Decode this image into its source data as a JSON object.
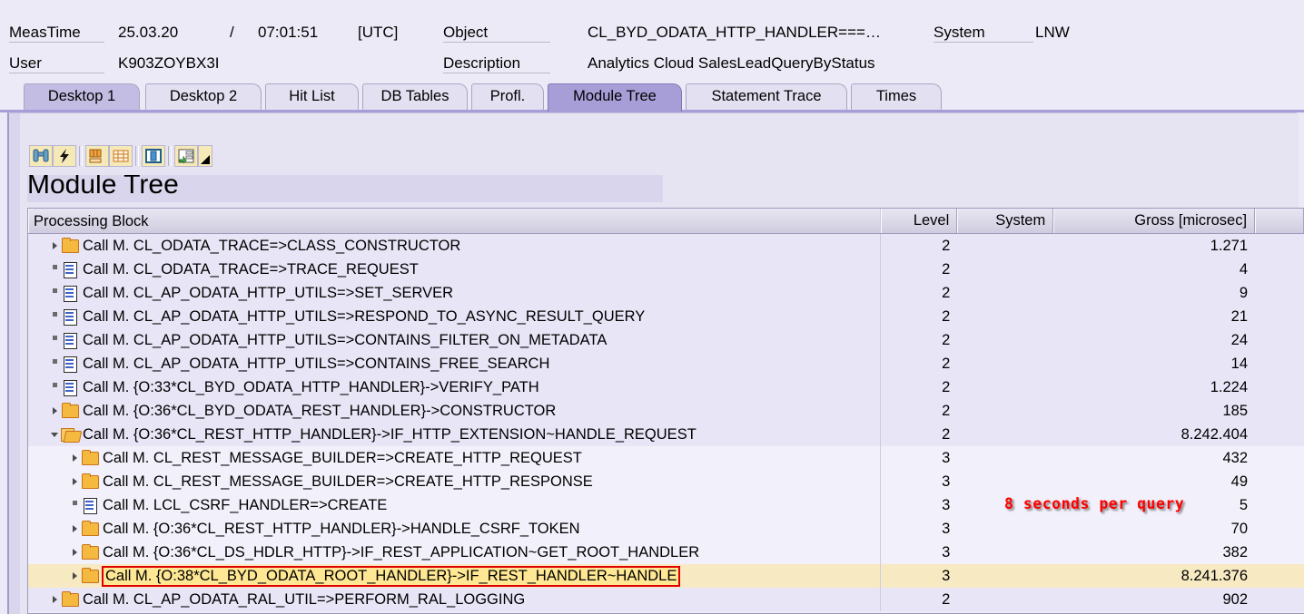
{
  "header": {
    "meastime_label": "MeasTime",
    "meastime_date": "25.03.20",
    "separator": "/",
    "meastime_time": "07:01:51",
    "timezone": "[UTC]",
    "user_label": "User",
    "user_value": "K903ZOYBX3I",
    "object_label": "Object",
    "object_value": "CL_BYD_ODATA_HTTP_HANDLER===…",
    "system_label": "System",
    "system_value": "LNW",
    "description_label": "Description",
    "description_value": "Analytics Cloud SalesLeadQueryByStatus"
  },
  "tabs": [
    {
      "label": "Desktop 1",
      "state": "first"
    },
    {
      "label": "Desktop 2",
      "state": "normal"
    },
    {
      "label": "Hit List",
      "state": "normal"
    },
    {
      "label": "DB Tables",
      "state": "normal"
    },
    {
      "label": "Profl.",
      "state": "normal"
    },
    {
      "label": "Module Tree",
      "state": "active"
    },
    {
      "label": "Statement Trace",
      "state": "normal"
    },
    {
      "label": "Times",
      "state": "normal"
    }
  ],
  "toolbar": {
    "buttons": [
      {
        "icon": "binoculars-icon"
      },
      {
        "icon": "lightning-bolt-icon"
      },
      {
        "icon": "table-layout-icon"
      },
      {
        "icon": "grid-layout-icon"
      },
      {
        "icon": "column-select-icon"
      },
      {
        "icon": "tree-export-icon"
      }
    ]
  },
  "title": "Module Tree",
  "grid": {
    "columns": [
      {
        "key": "block",
        "label": "Processing Block"
      },
      {
        "key": "level",
        "label": "Level"
      },
      {
        "key": "system",
        "label": "System"
      },
      {
        "key": "gross",
        "label": "Gross [microsec]"
      }
    ],
    "rows": [
      {
        "indent": 1,
        "node": "collapsed",
        "icon": "folder-icon",
        "block": "Call M. CL_ODATA_TRACE=>CLASS_CONSTRUCTOR",
        "level": "2",
        "system": "",
        "gross": "1.271",
        "shade": true,
        "selected": false
      },
      {
        "indent": 1,
        "node": "leaf",
        "icon": "document-icon",
        "block": "Call M. CL_ODATA_TRACE=>TRACE_REQUEST",
        "level": "2",
        "system": "",
        "gross": "4",
        "shade": true,
        "selected": false
      },
      {
        "indent": 1,
        "node": "leaf",
        "icon": "document-icon",
        "block": "Call M. CL_AP_ODATA_HTTP_UTILS=>SET_SERVER",
        "level": "2",
        "system": "",
        "gross": "9",
        "shade": true,
        "selected": false
      },
      {
        "indent": 1,
        "node": "leaf",
        "icon": "document-icon",
        "block": "Call M. CL_AP_ODATA_HTTP_UTILS=>RESPOND_TO_ASYNC_RESULT_QUERY",
        "level": "2",
        "system": "",
        "gross": "21",
        "shade": true,
        "selected": false
      },
      {
        "indent": 1,
        "node": "leaf",
        "icon": "document-icon",
        "block": "Call M. CL_AP_ODATA_HTTP_UTILS=>CONTAINS_FILTER_ON_METADATA",
        "level": "2",
        "system": "",
        "gross": "24",
        "shade": true,
        "selected": false
      },
      {
        "indent": 1,
        "node": "leaf",
        "icon": "document-icon",
        "block": "Call M. CL_AP_ODATA_HTTP_UTILS=>CONTAINS_FREE_SEARCH",
        "level": "2",
        "system": "",
        "gross": "14",
        "shade": true,
        "selected": false
      },
      {
        "indent": 1,
        "node": "leaf",
        "icon": "document-icon",
        "block": "Call M. {O:33*CL_BYD_ODATA_HTTP_HANDLER}->VERIFY_PATH",
        "level": "2",
        "system": "",
        "gross": "1.224",
        "shade": true,
        "selected": false
      },
      {
        "indent": 1,
        "node": "collapsed",
        "icon": "folder-icon",
        "block": "Call M. {O:36*CL_BYD_ODATA_REST_HANDLER}->CONSTRUCTOR",
        "level": "2",
        "system": "",
        "gross": "185",
        "shade": true,
        "selected": false
      },
      {
        "indent": 1,
        "node": "expanded",
        "icon": "folder-open-icon",
        "block": "Call M. {O:36*CL_REST_HTTP_HANDLER}->IF_HTTP_EXTENSION~HANDLE_REQUEST",
        "level": "2",
        "system": "",
        "gross": "8.242.404",
        "shade": true,
        "selected": false
      },
      {
        "indent": 2,
        "node": "collapsed",
        "icon": "folder-icon",
        "block": "Call M. CL_REST_MESSAGE_BUILDER=>CREATE_HTTP_REQUEST",
        "level": "3",
        "system": "",
        "gross": "432",
        "shade": false,
        "selected": false
      },
      {
        "indent": 2,
        "node": "collapsed",
        "icon": "folder-icon",
        "block": "Call M. CL_REST_MESSAGE_BUILDER=>CREATE_HTTP_RESPONSE",
        "level": "3",
        "system": "",
        "gross": "49",
        "shade": false,
        "selected": false
      },
      {
        "indent": 2,
        "node": "leaf",
        "icon": "document-icon",
        "block": "Call M. LCL_CSRF_HANDLER=>CREATE",
        "level": "3",
        "system": "",
        "gross": "5",
        "shade": false,
        "selected": false
      },
      {
        "indent": 2,
        "node": "collapsed",
        "icon": "folder-icon",
        "block": "Call M. {O:36*CL_REST_HTTP_HANDLER}->HANDLE_CSRF_TOKEN",
        "level": "3",
        "system": "",
        "gross": "70",
        "shade": false,
        "selected": false
      },
      {
        "indent": 2,
        "node": "collapsed",
        "icon": "folder-icon",
        "block": "Call M. {O:36*CL_DS_HDLR_HTTP}->IF_REST_APPLICATION~GET_ROOT_HANDLER",
        "level": "3",
        "system": "",
        "gross": "382",
        "shade": false,
        "selected": false
      },
      {
        "indent": 2,
        "node": "collapsed",
        "icon": "folder-icon",
        "block": "Call M. {O:38*CL_BYD_ODATA_ROOT_HANDLER}->IF_REST_HANDLER~HANDLE",
        "level": "3",
        "system": "",
        "gross": "8.241.376",
        "shade": false,
        "selected": true
      },
      {
        "indent": 1,
        "node": "collapsed",
        "icon": "folder-icon",
        "block": "Call M. CL_AP_ODATA_RAL_UTIL=>PERFORM_RAL_LOGGING",
        "level": "2",
        "system": "",
        "gross": "902",
        "shade": true,
        "selected": false
      }
    ]
  },
  "annotation": {
    "text": "8 seconds per query",
    "color": "#ff0000"
  },
  "colors": {
    "accent": "#a79ed8",
    "window_bg": "#eceaf6",
    "grid_bg": "#f2f1fb",
    "selection": "#ffe793",
    "selection_border": "#e00000"
  }
}
